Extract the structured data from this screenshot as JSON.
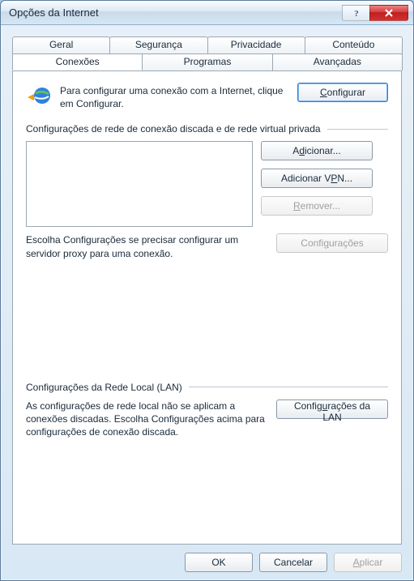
{
  "window": {
    "title": "Opções da Internet",
    "help_button_label": "?",
    "close_button_label": "X"
  },
  "tabs_row1": [
    {
      "label": "Geral"
    },
    {
      "label": "Segurança"
    },
    {
      "label": "Privacidade"
    },
    {
      "label": "Conteúdo"
    }
  ],
  "tabs_row2": [
    {
      "label": "Conexões",
      "active": true
    },
    {
      "label": "Programas"
    },
    {
      "label": "Avançadas"
    }
  ],
  "intro": {
    "text": "Para configurar uma conexão com a Internet, clique em Configurar.",
    "configure_label": "Configurar"
  },
  "dialup": {
    "section_title": "Configurações de rede de conexão discada e de rede virtual privada",
    "add_label": "Adicionar...",
    "add_vpn_label": "Adicionar VPN...",
    "remove_label": "Remover...",
    "proxy_text": "Escolha Configurações se precisar configurar um servidor proxy para uma conexão.",
    "settings_label": "Configurações",
    "connections": []
  },
  "lan": {
    "section_title": "Configurações da Rede Local (LAN)",
    "text": "As configurações de rede local não se aplicam a conexões discadas. Escolha Configurações acima para configurações de conexão discada.",
    "button_label": "Configurações da LAN"
  },
  "buttons": {
    "ok": "OK",
    "cancel": "Cancelar",
    "apply": "Aplicar"
  }
}
